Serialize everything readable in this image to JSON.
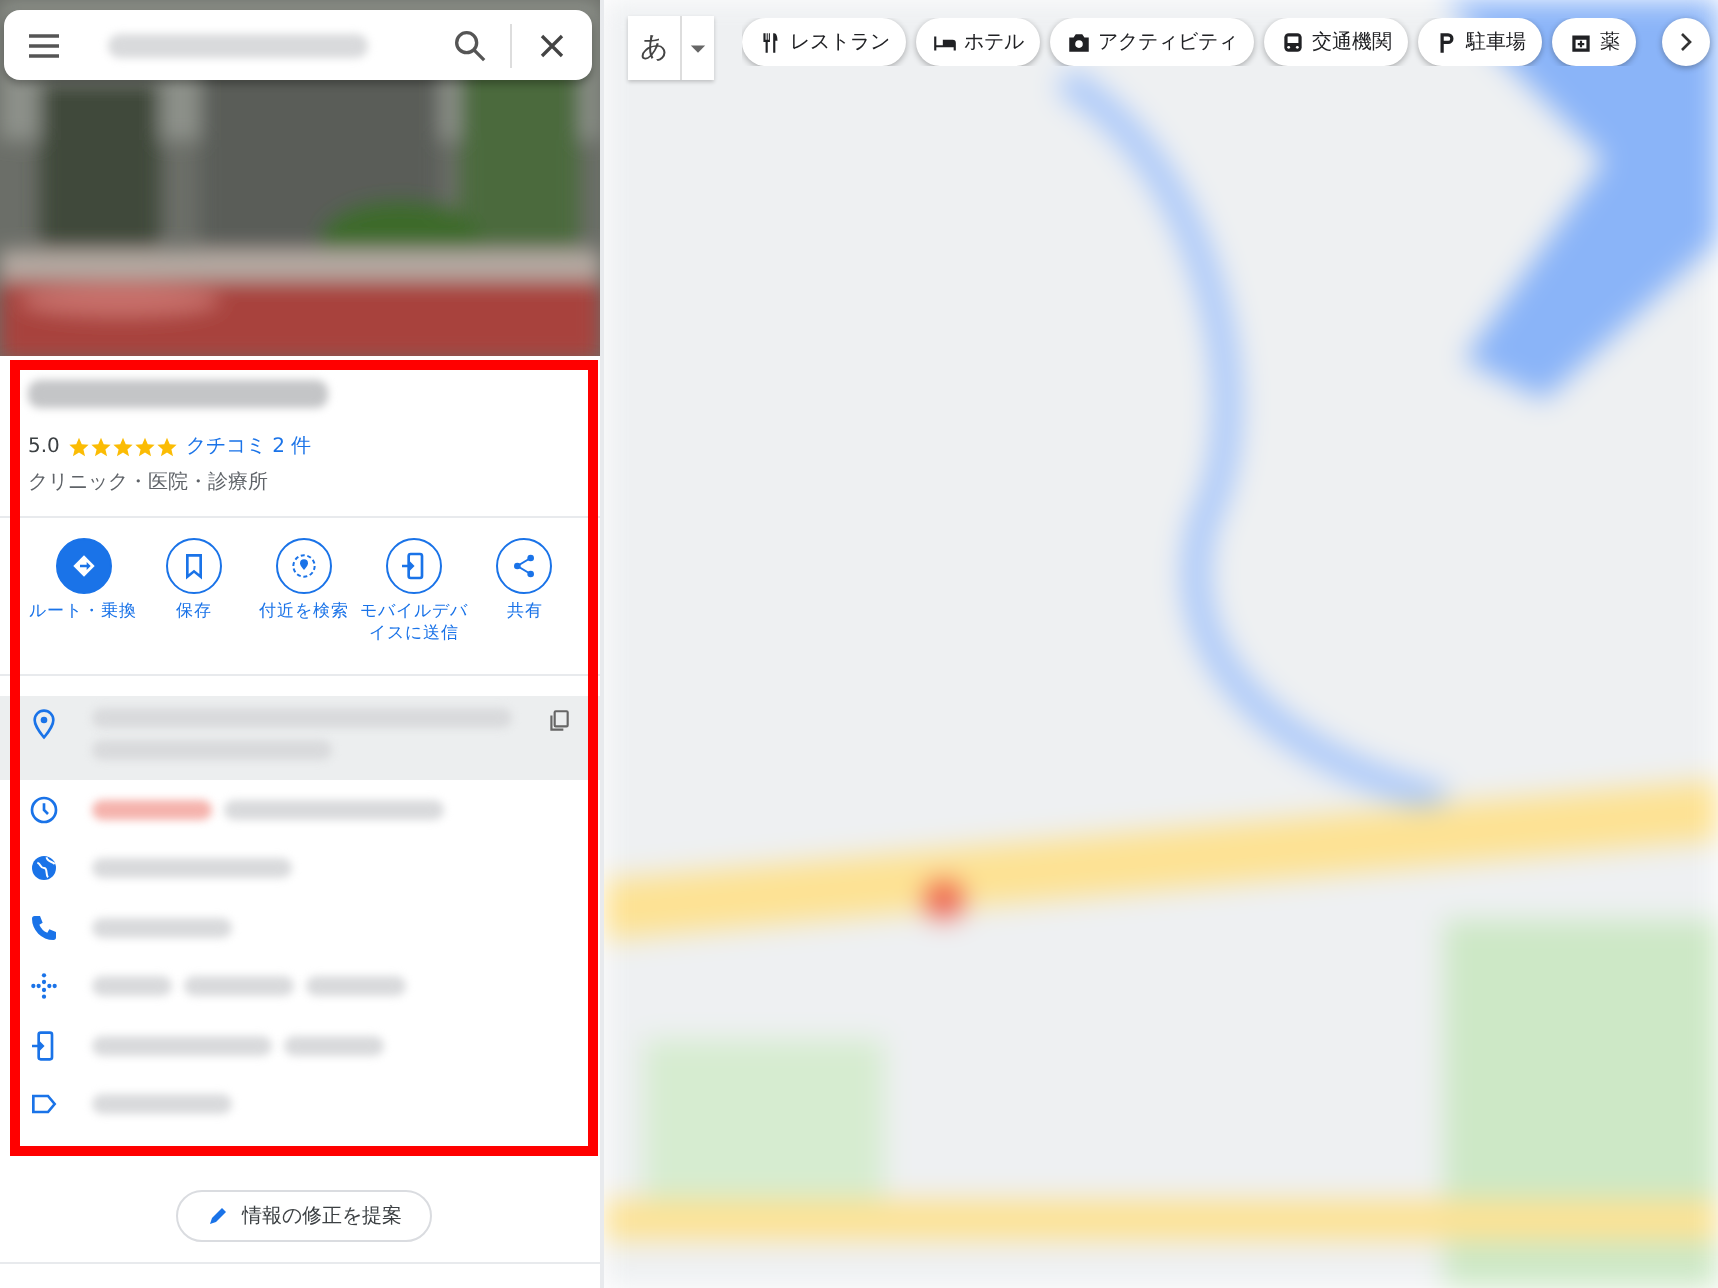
{
  "place": {
    "rating": "5.0",
    "stars": 5,
    "reviews": "クチコミ 2 件",
    "category": "クリニック・医院・診療所"
  },
  "actions": [
    {
      "kind": "route",
      "label": "ルート・乗換",
      "primary": true
    },
    {
      "kind": "save",
      "label": "保存",
      "primary": false
    },
    {
      "kind": "nearby",
      "label": "付近を検索",
      "primary": false
    },
    {
      "kind": "send",
      "label": "モバイルデバイスに送信",
      "primary": false
    },
    {
      "kind": "share",
      "label": "共有",
      "primary": false
    }
  ],
  "info_rows": [
    {
      "kind": "address",
      "hovered": true
    },
    {
      "kind": "hours",
      "hovered": false
    },
    {
      "kind": "website",
      "hovered": false
    },
    {
      "kind": "phone",
      "hovered": false
    },
    {
      "kind": "plus_code",
      "hovered": false
    },
    {
      "kind": "send",
      "hovered": false
    },
    {
      "kind": "label",
      "hovered": false
    }
  ],
  "suggest_edit": "情報の修正を提案",
  "map": {
    "input_tool": "あ",
    "chips": [
      {
        "kind": "restaurant",
        "label": "レストラン"
      },
      {
        "kind": "hotel",
        "label": "ホテル"
      },
      {
        "kind": "activity",
        "label": "アクティビティ"
      },
      {
        "kind": "transit",
        "label": "交通機関"
      },
      {
        "kind": "parking",
        "label": "駐車場"
      },
      {
        "kind": "pharmacy",
        "label": "薬"
      }
    ]
  }
}
